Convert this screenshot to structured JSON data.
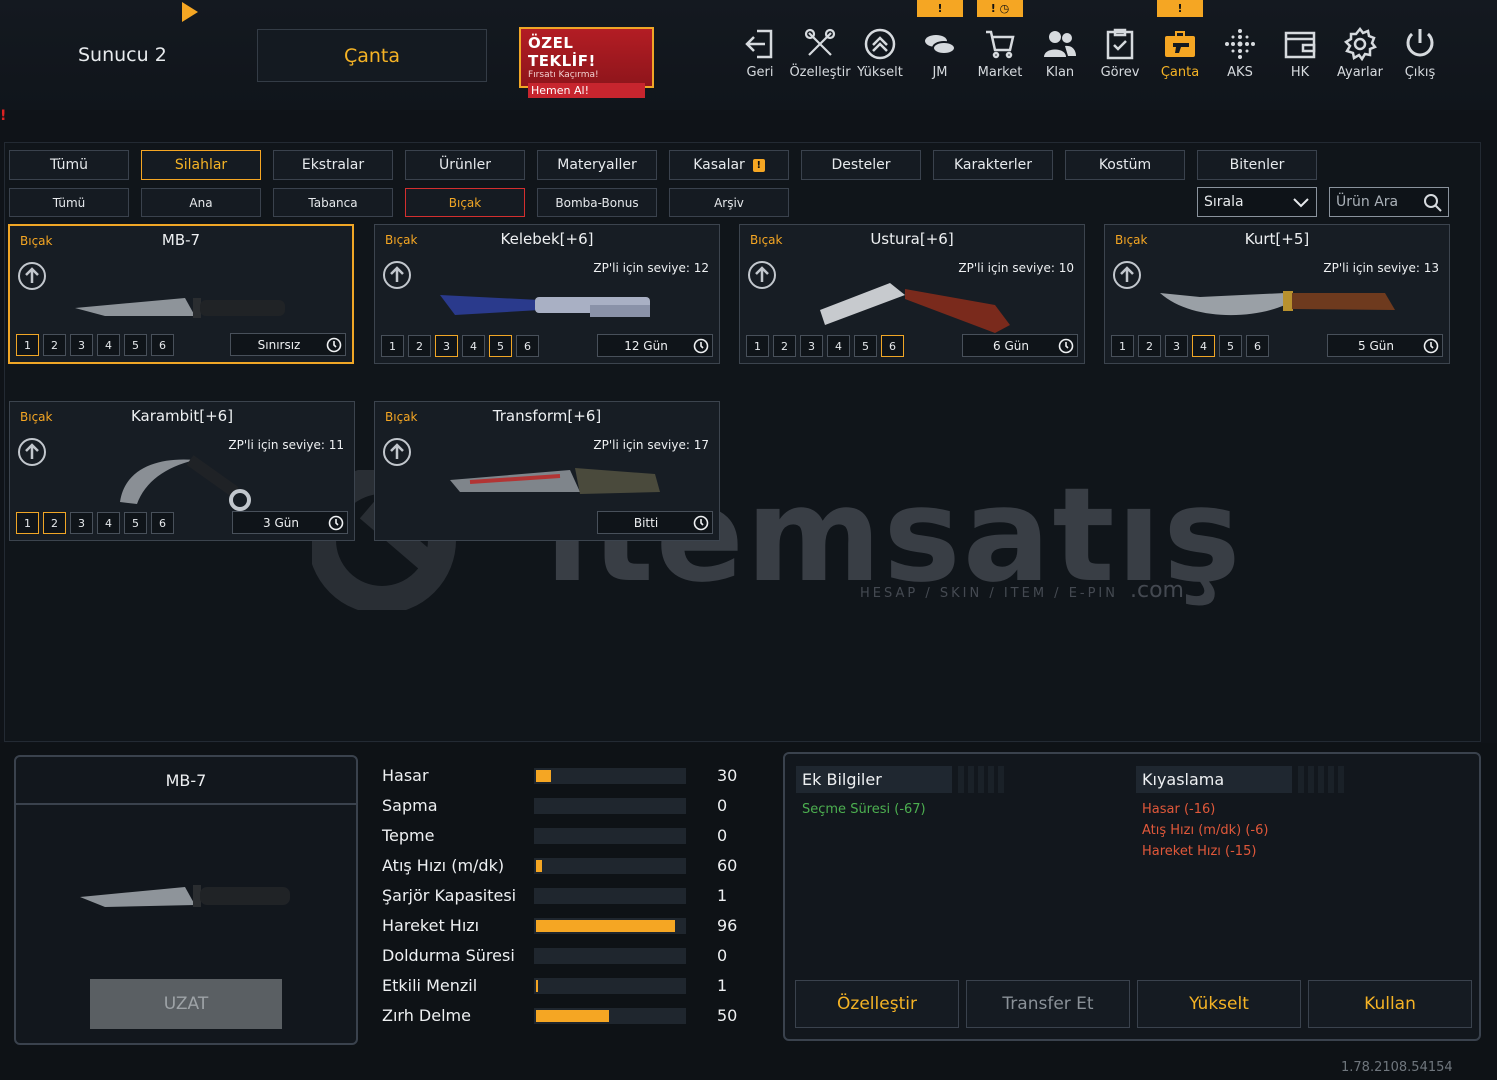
{
  "header": {
    "server": "Sunucu 2",
    "bag_tab": "Çanta",
    "offer": {
      "title": "ÖZEL TEKLİF!",
      "subtitle": "Fırsatı Kaçırma!",
      "cta": "Hemen Al!"
    },
    "nav": [
      {
        "label": "Geri",
        "icon": "back-icon"
      },
      {
        "label": "Özelleştir",
        "icon": "tools-icon"
      },
      {
        "label": "Yükselt",
        "icon": "upgrade-icon"
      },
      {
        "label": "JM",
        "icon": "coins-icon"
      },
      {
        "label": "Market",
        "icon": "cart-icon"
      },
      {
        "label": "Klan",
        "icon": "clan-icon"
      },
      {
        "label": "Görev",
        "icon": "mission-icon"
      },
      {
        "label": "Çanta",
        "icon": "bag-icon"
      },
      {
        "label": "AKS",
        "icon": "aks-icon"
      },
      {
        "label": "HK",
        "icon": "wallet-icon"
      },
      {
        "label": "Ayarlar",
        "icon": "gear-icon"
      },
      {
        "label": "Çıkış",
        "icon": "power-icon"
      }
    ],
    "badges": {
      "jm": "!",
      "market": "!",
      "gorev_warn": "!"
    },
    "alert": "!"
  },
  "tabs": [
    "Tümü",
    "Silahlar",
    "Ekstralar",
    "Ürünler",
    "Materyaller",
    "Kasalar",
    "Desteler",
    "Karakterler",
    "Kostüm",
    "Bitenler"
  ],
  "tabs_selected": "Silahlar",
  "kasalar_warn": "!",
  "subtabs": [
    "Tümü",
    "Ana",
    "Tabanca",
    "Bıçak",
    "Bomba-Bonus",
    "Arşiv"
  ],
  "subtabs_selected": "Bıçak",
  "sort": {
    "label": "Sırala"
  },
  "search": {
    "placeholder": "Ürün Ara"
  },
  "cards": [
    {
      "category": "Bıçak",
      "name": "MB-7",
      "level": "",
      "slots": [
        "1",
        "2",
        "3",
        "4",
        "5",
        "6"
      ],
      "active_slot": 0,
      "duration": "Sınırsız"
    },
    {
      "category": "Bıçak",
      "name": "Kelebek[+6]",
      "level": "ZP'li için seviye: 12",
      "slots": [
        "1",
        "2",
        "3",
        "4",
        "5",
        "6"
      ],
      "active_slot": 3,
      "active_slot2": 5,
      "duration": "12 Gün"
    },
    {
      "category": "Bıçak",
      "name": "Ustura[+6]",
      "level": "ZP'li için seviye: 10",
      "slots": [
        "1",
        "2",
        "3",
        "4",
        "5",
        "6"
      ],
      "active_slot": 6,
      "duration": "6 Gün"
    },
    {
      "category": "Bıçak",
      "name": "Kurt[+5]",
      "level": "ZP'li için seviye: 13",
      "slots": [
        "1",
        "2",
        "3",
        "4",
        "5",
        "6"
      ],
      "active_slot": 4,
      "duration": "5 Gün"
    },
    {
      "category": "Bıçak",
      "name": "Karambit[+6]",
      "level": "ZP'li için seviye: 11",
      "slots": [
        "1",
        "2",
        "3",
        "4",
        "5",
        "6"
      ],
      "active_slot": 1,
      "active_slot2": 2,
      "duration": "3 Gün"
    },
    {
      "category": "Bıçak",
      "name": "Transform[+6]",
      "level": "ZP'li için seviye: 17",
      "slots": [],
      "duration": "Bitti"
    }
  ],
  "watermark": {
    "text": "itemsatış",
    "sub": "HESAP / SKIN / ITEM / E-PIN",
    "com": ".com"
  },
  "preview": {
    "title": "MB-7",
    "extend": "UZAT"
  },
  "stats": [
    {
      "label": "Hasar",
      "value": "30",
      "fill": 0.1
    },
    {
      "label": "Sapma",
      "value": "0",
      "fill": 0
    },
    {
      "label": "Tepme",
      "value": "0",
      "fill": 0
    },
    {
      "label": "Atış Hızı (m/dk)",
      "value": "60",
      "fill": 0.04
    },
    {
      "label": "Şarjör Kapasitesi",
      "value": "1",
      "fill": 0
    },
    {
      "label": "Hareket Hızı",
      "value": "96",
      "fill": 0.94
    },
    {
      "label": "Doldurma Süresi",
      "value": "0",
      "fill": 0
    },
    {
      "label": "Etkili Menzil",
      "value": "1",
      "fill": 0.01
    },
    {
      "label": "Zırh Delme",
      "value": "50",
      "fill": 0.49
    }
  ],
  "info": {
    "extra_title": "Ek Bilgiler",
    "extra": [
      "Seçme Süresi (-67)"
    ],
    "compare_title": "Kıyaslama",
    "compare": [
      "Hasar (-16)",
      "Atış Hızı (m/dk) (-6)",
      "Hareket Hızı (-15)"
    ]
  },
  "actions": [
    "Özelleştir",
    "Transfer Et",
    "Yükselt",
    "Kullan"
  ],
  "version": "1.78.2108.54154",
  "colors": {
    "accent": "#f5a623",
    "bg": "#0f1318",
    "danger": "#d32f2f"
  }
}
